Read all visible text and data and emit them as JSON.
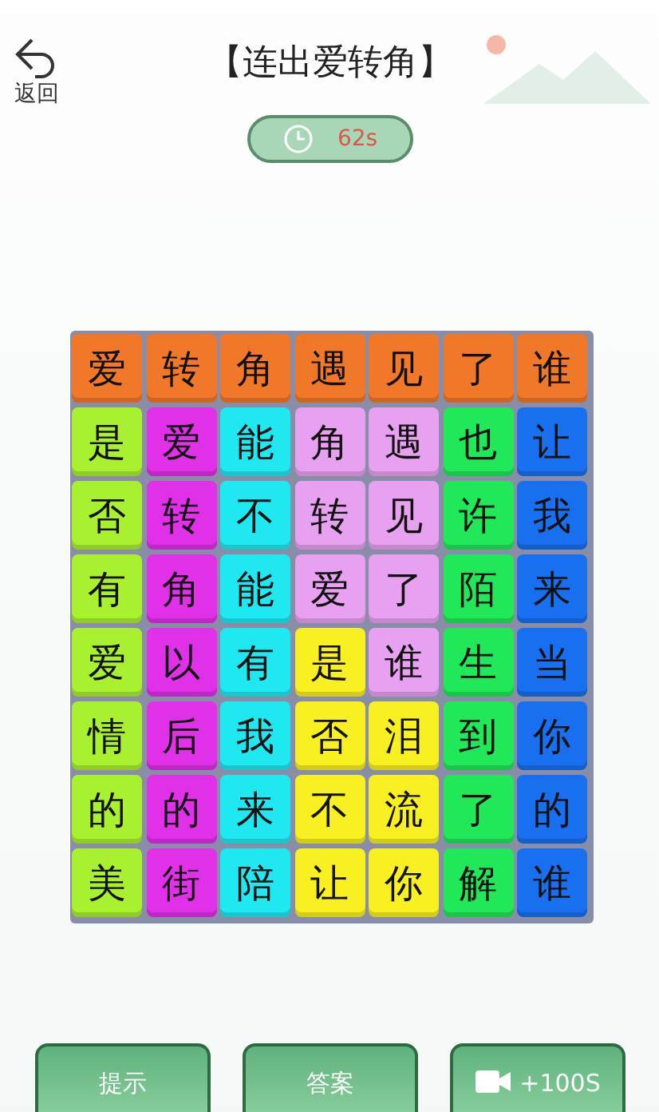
{
  "back": {
    "label": "返回"
  },
  "title": "【连出爱转角】",
  "timer": {
    "value": "62s"
  },
  "grid": [
    [
      {
        "char": "爱",
        "color": "#f07828"
      },
      {
        "char": "转",
        "color": "#f07828"
      },
      {
        "char": "角",
        "color": "#f07828"
      },
      {
        "char": "遇",
        "color": "#f07828"
      },
      {
        "char": "见",
        "color": "#f07828"
      },
      {
        "char": "了",
        "color": "#f07828"
      },
      {
        "char": "谁",
        "color": "#f07828"
      }
    ],
    [
      {
        "char": "是",
        "color": "#a8f030"
      },
      {
        "char": "爱",
        "color": "#e030e8"
      },
      {
        "char": "能",
        "color": "#20e8f0"
      },
      {
        "char": "角",
        "color": "#e8a0f0"
      },
      {
        "char": "遇",
        "color": "#e8a0f0"
      },
      {
        "char": "也",
        "color": "#20e858"
      },
      {
        "char": "让",
        "color": "#1870f0"
      }
    ],
    [
      {
        "char": "否",
        "color": "#a8f030"
      },
      {
        "char": "转",
        "color": "#e030e8"
      },
      {
        "char": "不",
        "color": "#20e8f0"
      },
      {
        "char": "转",
        "color": "#e8a0f0"
      },
      {
        "char": "见",
        "color": "#e8a0f0"
      },
      {
        "char": "许",
        "color": "#20e858"
      },
      {
        "char": "我",
        "color": "#1870f0"
      }
    ],
    [
      {
        "char": "有",
        "color": "#a8f030"
      },
      {
        "char": "角",
        "color": "#e030e8"
      },
      {
        "char": "能",
        "color": "#20e8f0"
      },
      {
        "char": "爱",
        "color": "#e8a0f0"
      },
      {
        "char": "了",
        "color": "#e8a0f0"
      },
      {
        "char": "陌",
        "color": "#20e858"
      },
      {
        "char": "来",
        "color": "#1870f0"
      }
    ],
    [
      {
        "char": "爱",
        "color": "#a8f030"
      },
      {
        "char": "以",
        "color": "#e030e8"
      },
      {
        "char": "有",
        "color": "#20e8f0"
      },
      {
        "char": "是",
        "color": "#f8f020"
      },
      {
        "char": "谁",
        "color": "#e8a0f0"
      },
      {
        "char": "生",
        "color": "#20e858"
      },
      {
        "char": "当",
        "color": "#1870f0"
      }
    ],
    [
      {
        "char": "情",
        "color": "#a8f030"
      },
      {
        "char": "后",
        "color": "#e030e8"
      },
      {
        "char": "我",
        "color": "#20e8f0"
      },
      {
        "char": "否",
        "color": "#f8f020"
      },
      {
        "char": "泪",
        "color": "#f8f020"
      },
      {
        "char": "到",
        "color": "#20e858"
      },
      {
        "char": "你",
        "color": "#1870f0"
      }
    ],
    [
      {
        "char": "的",
        "color": "#a8f030"
      },
      {
        "char": "的",
        "color": "#e030e8"
      },
      {
        "char": "来",
        "color": "#20e8f0"
      },
      {
        "char": "不",
        "color": "#f8f020"
      },
      {
        "char": "流",
        "color": "#f8f020"
      },
      {
        "char": "了",
        "color": "#20e858"
      },
      {
        "char": "的",
        "color": "#1870f0"
      }
    ],
    [
      {
        "char": "美",
        "color": "#a8f030"
      },
      {
        "char": "街",
        "color": "#e030e8"
      },
      {
        "char": "陪",
        "color": "#20e8f0"
      },
      {
        "char": "让",
        "color": "#f8f020"
      },
      {
        "char": "你",
        "color": "#f8f020"
      },
      {
        "char": "解",
        "color": "#20e858"
      },
      {
        "char": "谁",
        "color": "#1870f0"
      }
    ]
  ],
  "buttons": [
    {
      "kind": "text",
      "label": "提示"
    },
    {
      "kind": "text",
      "label": "答案"
    },
    {
      "kind": "video",
      "label": "+100S"
    }
  ]
}
